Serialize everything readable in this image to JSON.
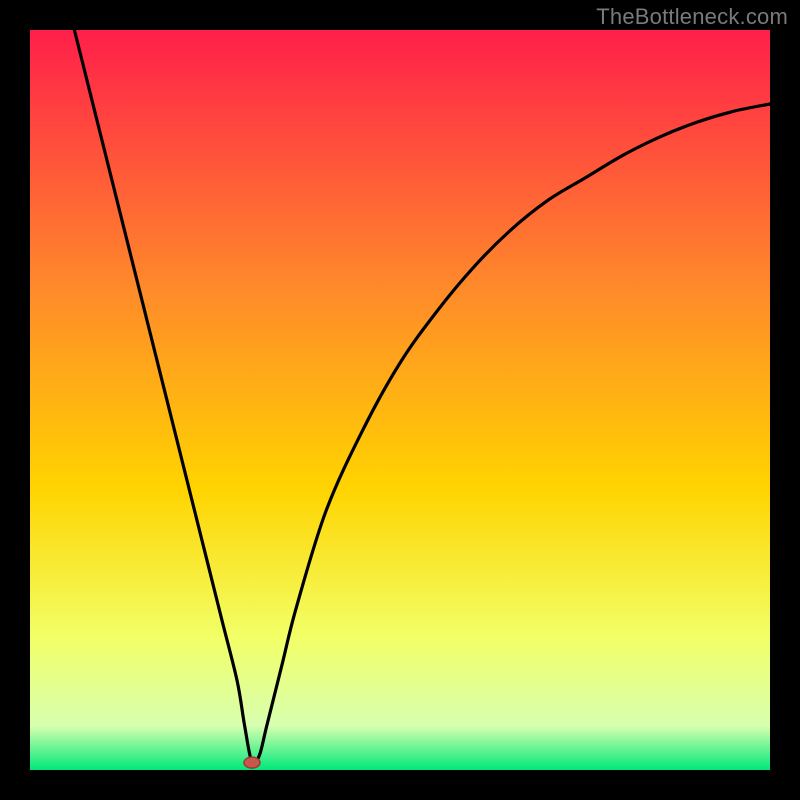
{
  "watermark": "TheBottleneck.com",
  "colors": {
    "top": "#ff1f4a",
    "mid_upper": "#ff8a2a",
    "mid": "#ffd400",
    "mid_lower": "#f2ff66",
    "pale_green": "#d8ffb0",
    "green": "#00e87a",
    "curve": "#000000",
    "marker_fill": "#c8584d",
    "marker_stroke": "#9e3a31"
  },
  "chart_data": {
    "type": "line",
    "title": "",
    "xlabel": "",
    "ylabel": "",
    "xlim": [
      0,
      100
    ],
    "ylim": [
      0,
      100
    ],
    "grid": false,
    "series": [
      {
        "name": "bottleneck-curve",
        "x": [
          6,
          8,
          10,
          12,
          14,
          16,
          18,
          20,
          22,
          24,
          26,
          28,
          29,
          30,
          31,
          32,
          34,
          36,
          40,
          45,
          50,
          55,
          60,
          65,
          70,
          75,
          80,
          85,
          90,
          95,
          100
        ],
        "y": [
          100,
          92,
          84,
          76,
          68,
          60,
          52,
          44,
          36,
          28,
          20,
          12,
          6,
          1,
          2,
          6,
          14,
          22,
          35,
          46,
          55,
          62,
          68,
          73,
          77,
          80,
          83,
          85.5,
          87.5,
          89,
          90
        ]
      }
    ],
    "marker": {
      "x": 30,
      "y": 1
    },
    "background_gradient": "stoplight-vertical"
  }
}
